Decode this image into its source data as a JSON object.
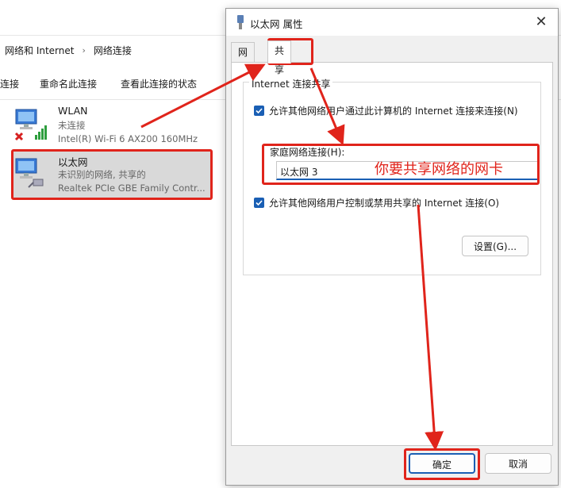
{
  "explorer": {
    "breadcrumb": [
      "网络和 Internet",
      "网络连接"
    ],
    "commands": [
      "连接",
      "重命名此连接",
      "查看此连接的状态"
    ],
    "adapters": [
      {
        "name": "WLAN",
        "status": "未连接",
        "device": "Intel(R) Wi-Fi 6 AX200 160MHz"
      },
      {
        "name": "以太网",
        "status": "未识别的网络, 共享的",
        "device": "Realtek PCIe GBE Family Contr..."
      }
    ]
  },
  "dialog": {
    "title": "以太网 属性",
    "tabs": [
      "网络",
      "共享"
    ],
    "group_title": "Internet 连接共享",
    "allow_share_label": "允许其他网络用户通过此计算机的 Internet 连接来连接(N)",
    "home_network_label": "家庭网络连接(H):",
    "home_network_value": "以太网 3",
    "allow_control_label": "允许其他网络用户控制或禁用共享的 Internet 连接(O)",
    "settings_button": "设置(G)...",
    "ok_button": "确定",
    "cancel_button": "取消"
  },
  "annotation": {
    "note": "你要共享网络的网卡",
    "color": "#e0241b"
  }
}
